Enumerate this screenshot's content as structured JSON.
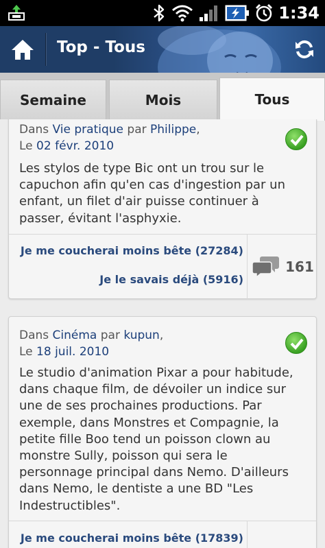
{
  "status_bar": {
    "time": "1:34",
    "icons": [
      "usb-icon",
      "bluetooth-icon",
      "wifi-icon",
      "signal-icon",
      "battery-charging-icon",
      "alarm-icon"
    ]
  },
  "action_bar": {
    "title": "Top - Tous",
    "home_icon": "home-icon",
    "refresh_icon": "refresh-icon"
  },
  "tabs": [
    {
      "label": "Semaine",
      "active": false
    },
    {
      "label": "Mois",
      "active": false
    },
    {
      "label": "Tous",
      "active": true
    }
  ],
  "colors": {
    "link": "#1c3f7a",
    "vote": "#2a4a7d",
    "check": "#3aa123",
    "actionbar": "#1f3d66"
  },
  "posts": [
    {
      "prefix": "Dans",
      "category": "Vie pratique",
      "by": "par",
      "author": "Philippe",
      "author_suffix": ",",
      "date_prefix": "Le",
      "date": "02 févr. 2010",
      "text": "Les stylos de type Bic ont un trou sur le capuchon afin qu'en cas d'ingestion par un enfant, un filet d'air puisse continuer à passer, évitant l'asphyxie.",
      "vote_learned": "Je me coucherai moins bête (27284)",
      "vote_known": "Je le savais déjà (5916)",
      "comment_count": "161"
    },
    {
      "prefix": "Dans",
      "category": "Cinéma",
      "by": "par",
      "author": "kupun",
      "author_suffix": ",",
      "date_prefix": "Le",
      "date": "18 juil. 2010",
      "text": "Le studio d'animation Pixar a pour habitude, dans chaque film, de dévoiler un indice sur une de ses prochaines productions. Par exemple, dans Monstres et Compagnie, la petite fille Boo tend un poisson clown au monstre Sully, poisson qui sera le personnage principal dans Nemo. D'ailleurs dans Nemo, le dentiste a une BD \"Les Indestructibles\".",
      "vote_learned": "Je me coucherai moins bête (17839)"
    }
  ]
}
